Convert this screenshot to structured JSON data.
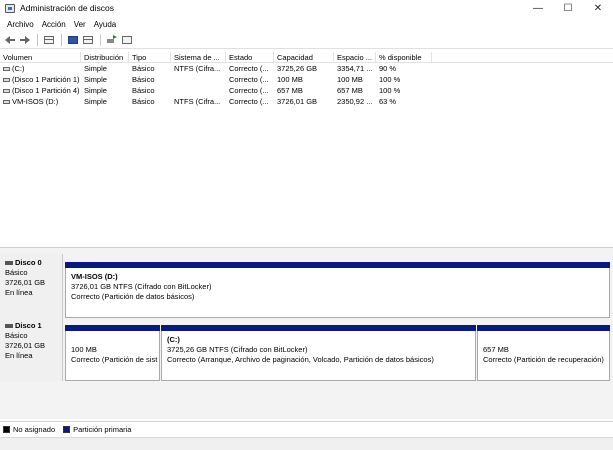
{
  "window": {
    "title": "Administración de discos",
    "minimize_glyph": "—",
    "maximize_glyph": "☐",
    "close_glyph": "✕"
  },
  "menu": [
    "Archivo",
    "Acción",
    "Ver",
    "Ayuda"
  ],
  "toolbar": {
    "icons": [
      "back-arrow-icon",
      "forward-arrow-icon",
      "console-tree-icon",
      "help-icon",
      "properties-icon",
      "rescan-icon",
      "view-icon"
    ]
  },
  "volume_table": {
    "headers": [
      "Volumen",
      "Distribución",
      "Tipo",
      "Sistema de ...",
      "Estado",
      "Capacidad",
      "Espacio ...",
      "% disponible",
      ""
    ],
    "rows": [
      [
        "(C:)",
        "Simple",
        "Básico",
        "NTFS (Cifra...",
        "Correcto (...",
        "3725,26 GB",
        "3354,71 ...",
        "90 %"
      ],
      [
        "(Disco 1 Partición 1)",
        "Simple",
        "Básico",
        "",
        "Correcto (...",
        "100 MB",
        "100 MB",
        "100 %"
      ],
      [
        "(Disco 1 Partición 4)",
        "Simple",
        "Básico",
        "",
        "Correcto (...",
        "657 MB",
        "657 MB",
        "100 %"
      ],
      [
        "VM-ISOS (D:)",
        "Simple",
        "Básico",
        "NTFS (Cifra...",
        "Correcto (...",
        "3726,01 GB",
        "2350,92 ...",
        "63 %"
      ]
    ]
  },
  "disks": [
    {
      "name": "Disco 0",
      "type": "Básico",
      "size": "3726,01 GB",
      "status": "En línea",
      "partitions": [
        {
          "title": "VM-ISOS  (D:)",
          "line1": "3726,01 GB NTFS (Cifrado con BitLocker)",
          "line2": "Correcto (Partición de datos básicos)"
        }
      ]
    },
    {
      "name": "Disco 1",
      "type": "Básico",
      "size": "3726,01 GB",
      "status": "En línea",
      "partitions": [
        {
          "title": "",
          "line1": "100 MB",
          "line2": "Correcto (Partición de sist"
        },
        {
          "title": "(C:)",
          "line1": "3725,26 GB NTFS (Cifrado con BitLocker)",
          "line2": "Correcto (Arranque, Archivo de paginación, Volcado, Partición de datos básicos)"
        },
        {
          "title": "",
          "line1": "657 MB",
          "line2": "Correcto (Partición de recuperación)"
        }
      ]
    }
  ],
  "legend": [
    {
      "label": "No asignado",
      "color": "#000000"
    },
    {
      "label": "Partición primaria",
      "color": "#0a1a7a"
    }
  ]
}
